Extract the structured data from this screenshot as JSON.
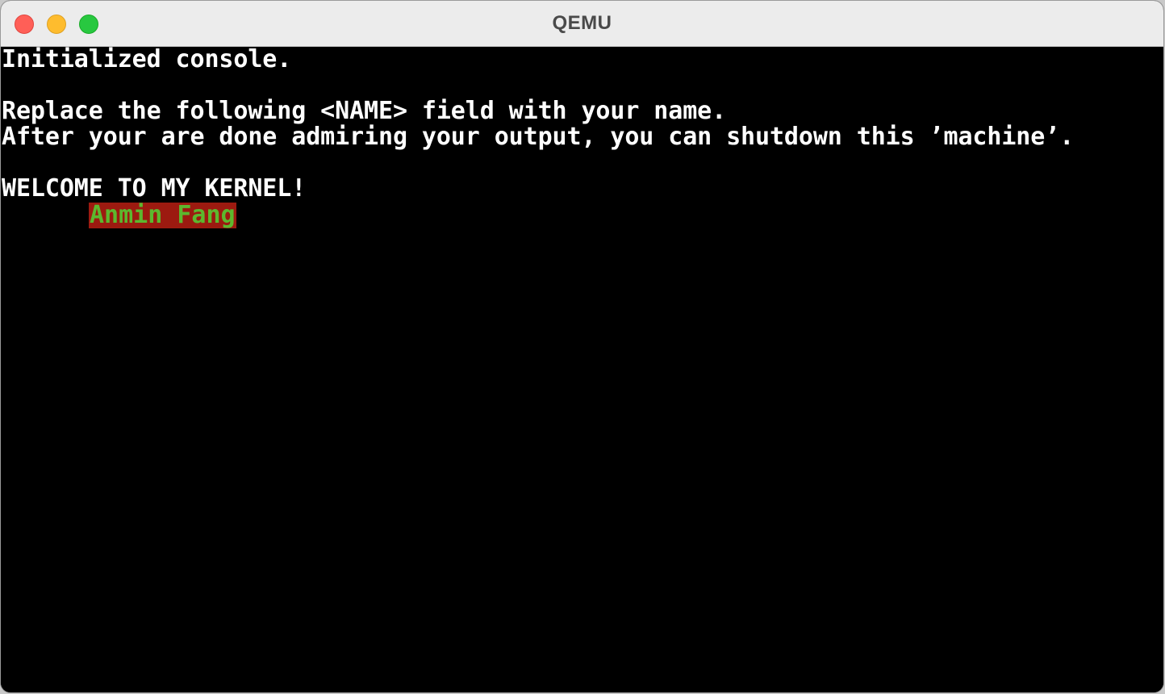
{
  "window": {
    "title": "QEMU"
  },
  "console": {
    "lines": [
      "Initialized console.",
      "",
      "Replace the following <NAME> field with your name.",
      "After your are done admiring your output, you can shutdown this ’machine’.",
      "",
      "WELCOME TO MY KERNEL!"
    ],
    "name": "Anmin Fang",
    "colors": {
      "background": "#000000",
      "text": "#ffffff",
      "name_background": "#9c1a10",
      "name_text": "#5cb82e"
    }
  },
  "icons": {
    "close": "close-traffic-light-icon",
    "minimize": "minimize-traffic-light-icon",
    "maximize": "maximize-traffic-light-icon"
  }
}
